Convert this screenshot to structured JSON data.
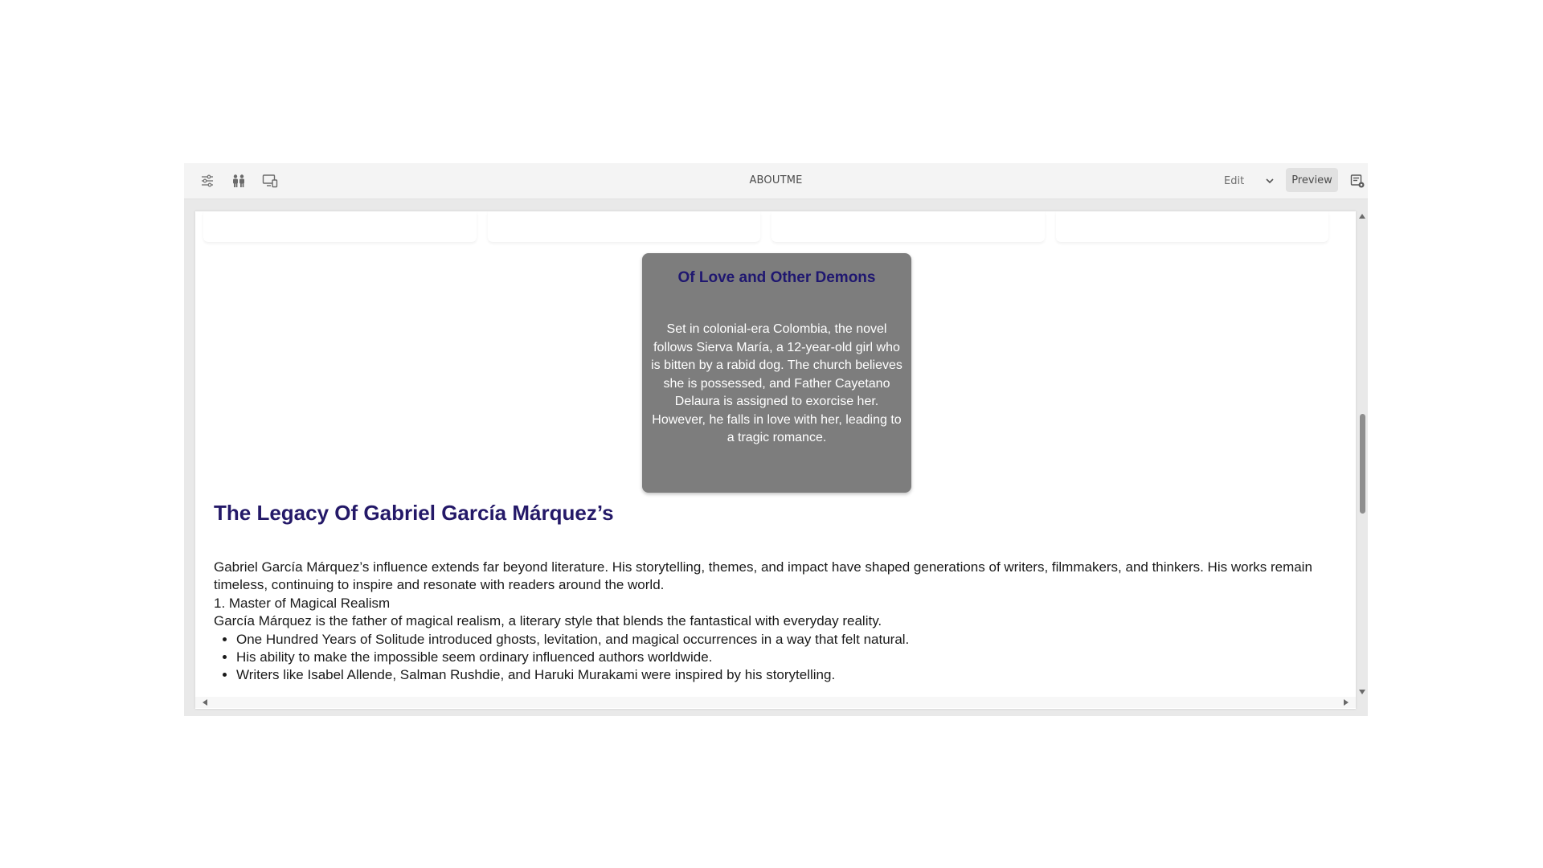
{
  "toolbar": {
    "title": "ABOUTME",
    "icons": [
      "properties-icon",
      "people-icon",
      "emulator-icon"
    ],
    "mode_label": "Edit",
    "preview_label": "Preview",
    "page-info-icon": "page-info-icon"
  },
  "book_card": {
    "title": "Of Love and Other Demons",
    "description": "Set in colonial-era Colombia, the novel follows Sierva María, a 12-year-old girl who is bitten by a rabid dog. The church believes she is possessed, and Father Cayetano Delaura is assigned to exorcise her. However, he falls in love with her, leading to a tragic romance.",
    "background": "#7d7d7d",
    "title_color": "#1f1770"
  },
  "section": {
    "heading": "The Legacy Of Gabriel García Márquez’s",
    "heading_color": "#241968",
    "intro": "Gabriel García Márquez’s influence extends far beyond literature. His storytelling, themes, and impact have shaped generations of writers, filmmakers, and thinkers. His works remain timeless, continuing to inspire and resonate with readers around the world.",
    "subheading": "1. Master of Magical Realism",
    "subtext": "García Márquez is the father of magical realism, a literary style that blends the fantastical with everyday reality.",
    "bullets": [
      "One Hundred Years of Solitude introduced ghosts, levitation, and magical occurrences in a way that felt natural.",
      "His ability to make the impossible seem ordinary influenced authors worldwide.",
      "Writers like Isabel Allende, Salman Rushdie, and Haruki Murakami were inspired by his storytelling."
    ]
  }
}
